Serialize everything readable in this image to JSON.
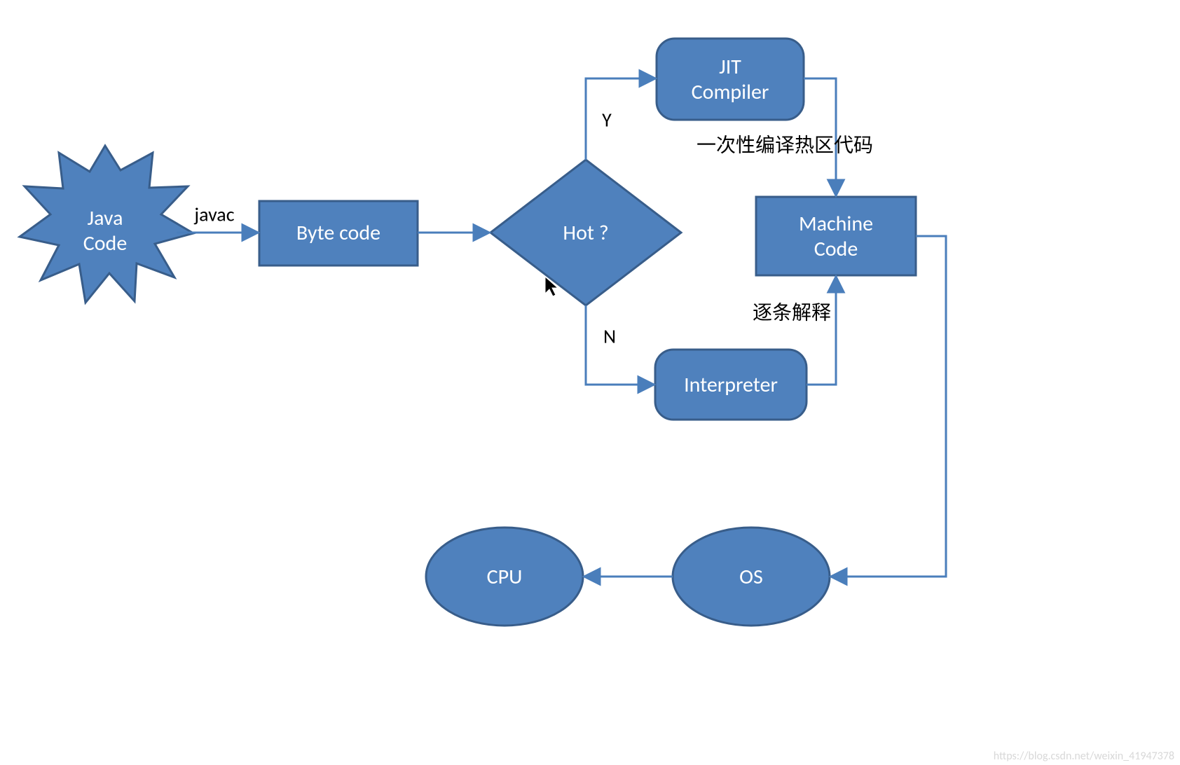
{
  "nodes": {
    "java_code": {
      "line1": "Java",
      "line2": "Code"
    },
    "byte_code": "Byte code",
    "hot": "Hot ?",
    "jit": {
      "line1": "JIT",
      "line2": "Compiler"
    },
    "interpreter": "Interpreter",
    "machine_code": {
      "line1": "Machine",
      "line2": "Code"
    },
    "os": "OS",
    "cpu": "CPU"
  },
  "labels": {
    "javac": "javac",
    "y": "Y",
    "n": "N",
    "compile_hot": "一次性编译热区代码",
    "interpret_each": "逐条解释"
  },
  "watermark": "https://blog.csdn.net/weixin_41947378",
  "colors": {
    "fill": "#4f81bd",
    "stroke": "#385d8a",
    "line": "#4a7ebb"
  }
}
